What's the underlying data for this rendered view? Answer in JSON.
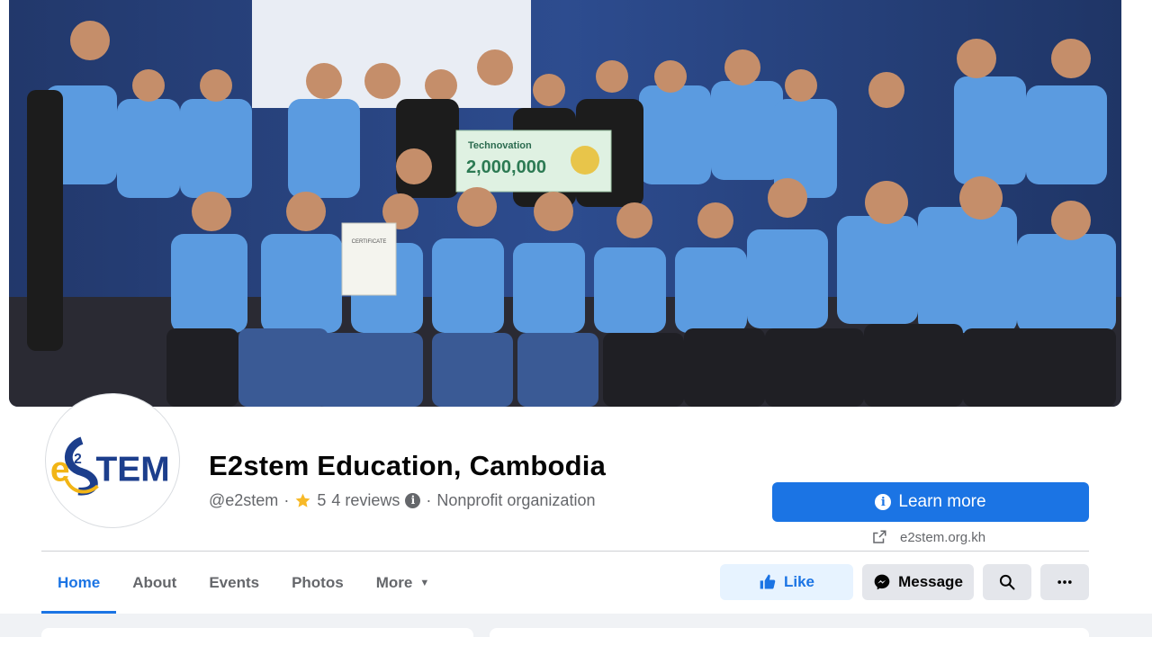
{
  "page": {
    "name": "E2stem Education, Cambodia",
    "handle": "@e2stem",
    "rating_value": "5",
    "reviews_label": "4 reviews",
    "category": "Nonprofit organization",
    "separator": "·"
  },
  "logo": {
    "text_e": "e",
    "text_2": "2",
    "text_stem": "TEM",
    "text_s": "S"
  },
  "cover": {
    "certificate_label": "CERTIFICATE",
    "prize_brand": "Technovation",
    "prize_amount": "2,000,000"
  },
  "cta": {
    "learn_more_label": "Learn more",
    "website_label": "e2stem.org.kh"
  },
  "tabs": [
    {
      "label": "Home",
      "active": true
    },
    {
      "label": "About",
      "active": false
    },
    {
      "label": "Events",
      "active": false
    },
    {
      "label": "Photos",
      "active": false
    },
    {
      "label": "More",
      "active": false
    }
  ],
  "actions": {
    "like_label": "Like",
    "message_label": "Message"
  },
  "icons": {
    "star": "star-icon",
    "info": "info-icon",
    "external_link": "external-link-icon",
    "like": "thumbs-up-icon",
    "message": "messenger-icon",
    "search": "search-icon",
    "more": "ellipsis-icon",
    "caret": "caret-down-icon"
  },
  "colors": {
    "brand_blue": "#1b74e4",
    "like_bg": "#e7f3ff",
    "button_gray": "#e4e6eb",
    "text_secondary": "#65676b",
    "star": "#f7b928"
  }
}
